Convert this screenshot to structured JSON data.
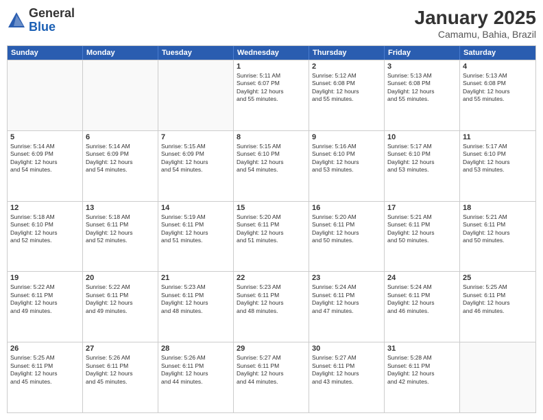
{
  "logo": {
    "line1": "General",
    "line2": "Blue"
  },
  "title": "January 2025",
  "subtitle": "Camamu, Bahia, Brazil",
  "header_days": [
    "Sunday",
    "Monday",
    "Tuesday",
    "Wednesday",
    "Thursday",
    "Friday",
    "Saturday"
  ],
  "rows": [
    [
      {
        "day": "",
        "lines": [],
        "empty": true
      },
      {
        "day": "",
        "lines": [],
        "empty": true
      },
      {
        "day": "",
        "lines": [],
        "empty": true
      },
      {
        "day": "1",
        "lines": [
          "Sunrise: 5:11 AM",
          "Sunset: 6:07 PM",
          "Daylight: 12 hours",
          "and 55 minutes."
        ],
        "empty": false
      },
      {
        "day": "2",
        "lines": [
          "Sunrise: 5:12 AM",
          "Sunset: 6:08 PM",
          "Daylight: 12 hours",
          "and 55 minutes."
        ],
        "empty": false
      },
      {
        "day": "3",
        "lines": [
          "Sunrise: 5:13 AM",
          "Sunset: 6:08 PM",
          "Daylight: 12 hours",
          "and 55 minutes."
        ],
        "empty": false
      },
      {
        "day": "4",
        "lines": [
          "Sunrise: 5:13 AM",
          "Sunset: 6:08 PM",
          "Daylight: 12 hours",
          "and 55 minutes."
        ],
        "empty": false
      }
    ],
    [
      {
        "day": "5",
        "lines": [
          "Sunrise: 5:14 AM",
          "Sunset: 6:09 PM",
          "Daylight: 12 hours",
          "and 54 minutes."
        ],
        "empty": false
      },
      {
        "day": "6",
        "lines": [
          "Sunrise: 5:14 AM",
          "Sunset: 6:09 PM",
          "Daylight: 12 hours",
          "and 54 minutes."
        ],
        "empty": false
      },
      {
        "day": "7",
        "lines": [
          "Sunrise: 5:15 AM",
          "Sunset: 6:09 PM",
          "Daylight: 12 hours",
          "and 54 minutes."
        ],
        "empty": false
      },
      {
        "day": "8",
        "lines": [
          "Sunrise: 5:15 AM",
          "Sunset: 6:10 PM",
          "Daylight: 12 hours",
          "and 54 minutes."
        ],
        "empty": false
      },
      {
        "day": "9",
        "lines": [
          "Sunrise: 5:16 AM",
          "Sunset: 6:10 PM",
          "Daylight: 12 hours",
          "and 53 minutes."
        ],
        "empty": false
      },
      {
        "day": "10",
        "lines": [
          "Sunrise: 5:17 AM",
          "Sunset: 6:10 PM",
          "Daylight: 12 hours",
          "and 53 minutes."
        ],
        "empty": false
      },
      {
        "day": "11",
        "lines": [
          "Sunrise: 5:17 AM",
          "Sunset: 6:10 PM",
          "Daylight: 12 hours",
          "and 53 minutes."
        ],
        "empty": false
      }
    ],
    [
      {
        "day": "12",
        "lines": [
          "Sunrise: 5:18 AM",
          "Sunset: 6:10 PM",
          "Daylight: 12 hours",
          "and 52 minutes."
        ],
        "empty": false
      },
      {
        "day": "13",
        "lines": [
          "Sunrise: 5:18 AM",
          "Sunset: 6:11 PM",
          "Daylight: 12 hours",
          "and 52 minutes."
        ],
        "empty": false
      },
      {
        "day": "14",
        "lines": [
          "Sunrise: 5:19 AM",
          "Sunset: 6:11 PM",
          "Daylight: 12 hours",
          "and 51 minutes."
        ],
        "empty": false
      },
      {
        "day": "15",
        "lines": [
          "Sunrise: 5:20 AM",
          "Sunset: 6:11 PM",
          "Daylight: 12 hours",
          "and 51 minutes."
        ],
        "empty": false
      },
      {
        "day": "16",
        "lines": [
          "Sunrise: 5:20 AM",
          "Sunset: 6:11 PM",
          "Daylight: 12 hours",
          "and 50 minutes."
        ],
        "empty": false
      },
      {
        "day": "17",
        "lines": [
          "Sunrise: 5:21 AM",
          "Sunset: 6:11 PM",
          "Daylight: 12 hours",
          "and 50 minutes."
        ],
        "empty": false
      },
      {
        "day": "18",
        "lines": [
          "Sunrise: 5:21 AM",
          "Sunset: 6:11 PM",
          "Daylight: 12 hours",
          "and 50 minutes."
        ],
        "empty": false
      }
    ],
    [
      {
        "day": "19",
        "lines": [
          "Sunrise: 5:22 AM",
          "Sunset: 6:11 PM",
          "Daylight: 12 hours",
          "and 49 minutes."
        ],
        "empty": false
      },
      {
        "day": "20",
        "lines": [
          "Sunrise: 5:22 AM",
          "Sunset: 6:11 PM",
          "Daylight: 12 hours",
          "and 49 minutes."
        ],
        "empty": false
      },
      {
        "day": "21",
        "lines": [
          "Sunrise: 5:23 AM",
          "Sunset: 6:11 PM",
          "Daylight: 12 hours",
          "and 48 minutes."
        ],
        "empty": false
      },
      {
        "day": "22",
        "lines": [
          "Sunrise: 5:23 AM",
          "Sunset: 6:11 PM",
          "Daylight: 12 hours",
          "and 48 minutes."
        ],
        "empty": false
      },
      {
        "day": "23",
        "lines": [
          "Sunrise: 5:24 AM",
          "Sunset: 6:11 PM",
          "Daylight: 12 hours",
          "and 47 minutes."
        ],
        "empty": false
      },
      {
        "day": "24",
        "lines": [
          "Sunrise: 5:24 AM",
          "Sunset: 6:11 PM",
          "Daylight: 12 hours",
          "and 46 minutes."
        ],
        "empty": false
      },
      {
        "day": "25",
        "lines": [
          "Sunrise: 5:25 AM",
          "Sunset: 6:11 PM",
          "Daylight: 12 hours",
          "and 46 minutes."
        ],
        "empty": false
      }
    ],
    [
      {
        "day": "26",
        "lines": [
          "Sunrise: 5:25 AM",
          "Sunset: 6:11 PM",
          "Daylight: 12 hours",
          "and 45 minutes."
        ],
        "empty": false
      },
      {
        "day": "27",
        "lines": [
          "Sunrise: 5:26 AM",
          "Sunset: 6:11 PM",
          "Daylight: 12 hours",
          "and 45 minutes."
        ],
        "empty": false
      },
      {
        "day": "28",
        "lines": [
          "Sunrise: 5:26 AM",
          "Sunset: 6:11 PM",
          "Daylight: 12 hours",
          "and 44 minutes."
        ],
        "empty": false
      },
      {
        "day": "29",
        "lines": [
          "Sunrise: 5:27 AM",
          "Sunset: 6:11 PM",
          "Daylight: 12 hours",
          "and 44 minutes."
        ],
        "empty": false
      },
      {
        "day": "30",
        "lines": [
          "Sunrise: 5:27 AM",
          "Sunset: 6:11 PM",
          "Daylight: 12 hours",
          "and 43 minutes."
        ],
        "empty": false
      },
      {
        "day": "31",
        "lines": [
          "Sunrise: 5:28 AM",
          "Sunset: 6:11 PM",
          "Daylight: 12 hours",
          "and 42 minutes."
        ],
        "empty": false
      },
      {
        "day": "",
        "lines": [],
        "empty": true
      }
    ]
  ]
}
